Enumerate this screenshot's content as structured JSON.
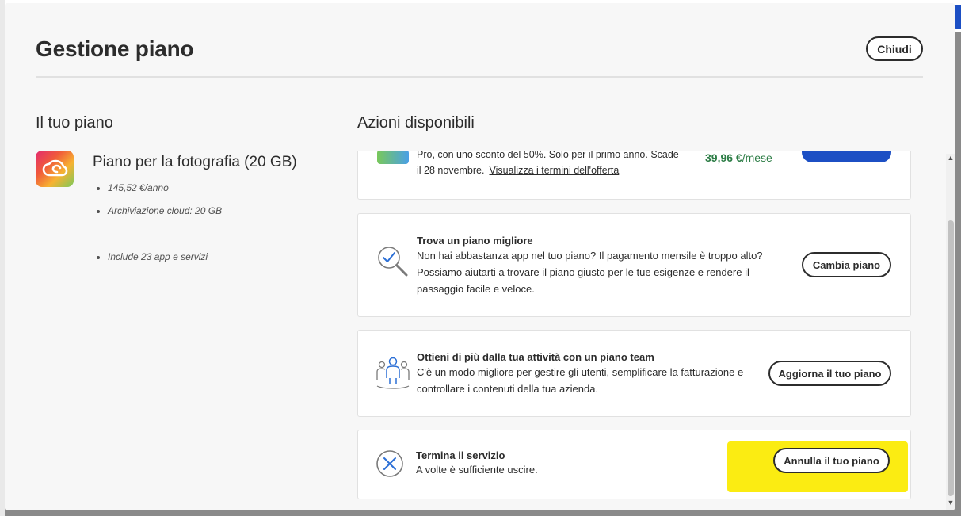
{
  "modal": {
    "title": "Gestione piano",
    "close_label": "Chiudi"
  },
  "your_plan": {
    "section_title": "Il tuo piano",
    "plan_name": "Piano per la fotografia (20 GB)",
    "details": [
      "145,52 €/anno",
      "Archiviazione cloud: 20 GB",
      "Include 23 app e servizi"
    ]
  },
  "actions": {
    "section_title": "Azioni disponibili",
    "offer_card": {
      "text_line1": "Pro, con uno sconto del 50%. Solo per il primo anno. Scade",
      "text_line2": "il 28 novembre.",
      "link": "Visualizza i termini dell'offerta",
      "price_value": "39,96 €",
      "price_unit": "/mese"
    },
    "better_plan": {
      "title": "Trova un piano migliore",
      "line1": "Non hai abbastanza app nel tuo piano? Il pagamento mensile è troppo alto?",
      "line2": "Possiamo aiutarti a trovare il piano giusto per le tue esigenze e rendere il",
      "line3": "passaggio facile e veloce.",
      "button": "Cambia piano"
    },
    "team_plan": {
      "title": "Ottieni di più dalla tua attività con un piano team",
      "line1": "C'è un modo migliore per gestire gli utenti, semplificare la fatturazione e",
      "line2": "controllare i contenuti della tua azienda.",
      "button": "Aggiorna il tuo piano"
    },
    "cancel": {
      "title": "Termina il servizio",
      "line1": "A volte è sufficiente uscire.",
      "button": "Annulla il tuo piano"
    }
  },
  "colors": {
    "primary_blue": "#1c4fc4",
    "price_green": "#2d7d46",
    "highlight_yellow": "#fbec12",
    "icon_blue": "#2b6fd6"
  }
}
